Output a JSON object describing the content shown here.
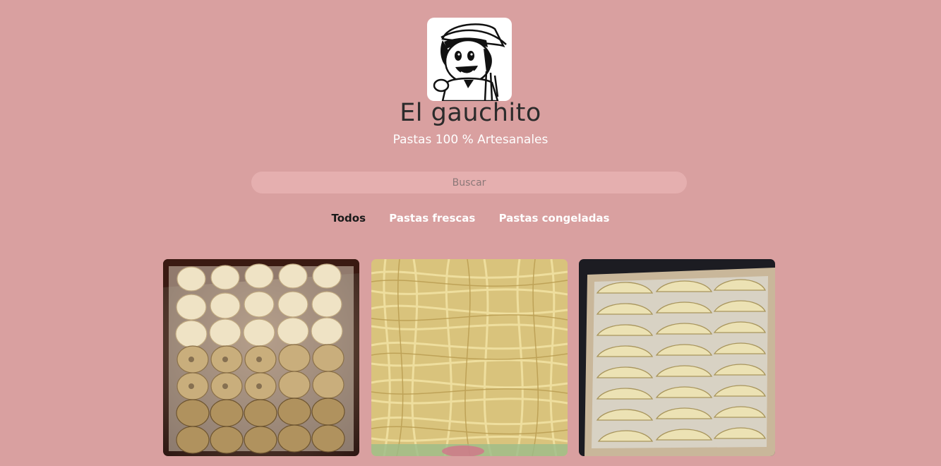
{
  "header": {
    "logo_icon": "gaucho-logo",
    "title": "El gauchito",
    "subtitle": "Pastas 100 % Artesanales"
  },
  "search": {
    "placeholder": "Buscar"
  },
  "tabs": [
    {
      "label": "Todos",
      "active": true
    },
    {
      "label": "Pastas frescas",
      "active": false
    },
    {
      "label": "Pastas congeladas",
      "active": false
    }
  ],
  "products": [
    {
      "image_subject": "cappelletti in a box"
    },
    {
      "image_subject": "fresh tagliatelle"
    },
    {
      "image_subject": "empanadas in a box"
    }
  ],
  "colors": {
    "background": "#d9a0a0",
    "search_bg": "#e5afaf",
    "tab_active": "#1a1a1a",
    "tab_inactive": "#ffffff"
  }
}
